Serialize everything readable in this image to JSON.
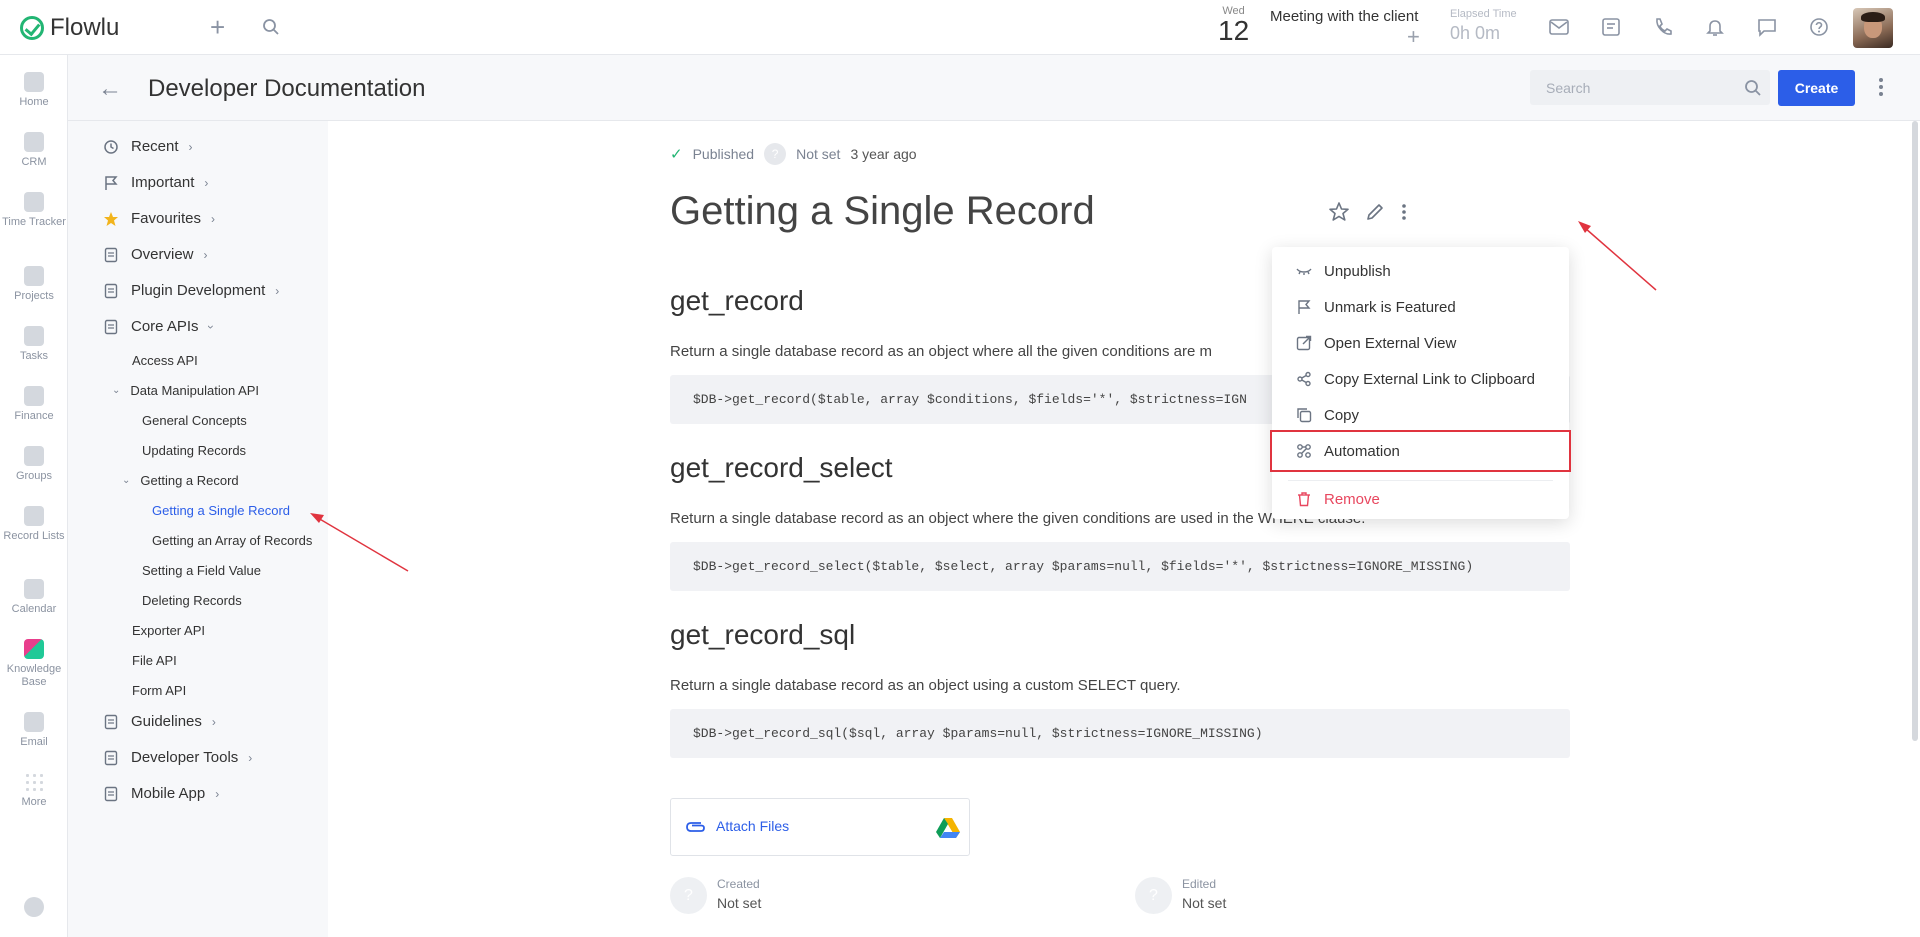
{
  "topbar": {
    "brand": "Flowlu",
    "date": {
      "weekday": "Wed",
      "day": "12"
    },
    "meeting": "Meeting with the client",
    "elapsed": {
      "label": "Elapsed Time",
      "value": "0h 0m"
    }
  },
  "rail": {
    "items": [
      {
        "label": "Home"
      },
      {
        "label": "CRM"
      },
      {
        "label": "Time Tracker"
      },
      {
        "label": "Projects"
      },
      {
        "label": "Tasks"
      },
      {
        "label": "Finance"
      },
      {
        "label": "Groups"
      },
      {
        "label": "Record Lists"
      },
      {
        "label": "Calendar"
      },
      {
        "label": "Knowledge Base"
      },
      {
        "label": "Email"
      },
      {
        "label": "More"
      }
    ]
  },
  "header": {
    "title": "Developer Documentation",
    "search_placeholder": "Search",
    "create_label": "Create"
  },
  "tree": {
    "top": [
      {
        "label": "Recent",
        "icon": "history-icon"
      },
      {
        "label": "Important",
        "icon": "flag-icon"
      },
      {
        "label": "Favourites",
        "icon": "star-icon"
      },
      {
        "label": "Overview",
        "icon": "document-icon"
      },
      {
        "label": "Plugin Development",
        "icon": "document-icon"
      },
      {
        "label": "Core APIs",
        "icon": "document-icon"
      }
    ],
    "sub": [
      {
        "label": "Access API"
      },
      {
        "label": "Data Manipulation API"
      },
      {
        "label": "General Concepts"
      },
      {
        "label": "Updating Records"
      },
      {
        "label": "Getting a Record"
      },
      {
        "label": "Getting a Single Record"
      },
      {
        "label": "Getting an Array of Records"
      },
      {
        "label": "Setting a Field Value"
      },
      {
        "label": "Deleting Records"
      },
      {
        "label": "Exporter API"
      },
      {
        "label": "File API"
      },
      {
        "label": "Form API"
      }
    ],
    "bottom": [
      {
        "label": "Guidelines"
      },
      {
        "label": "Developer Tools"
      },
      {
        "label": "Mobile App"
      }
    ]
  },
  "article": {
    "status": "Published",
    "owner": "Not set",
    "updated": "3 year ago",
    "title": "Getting a Single Record",
    "sections": [
      {
        "heading": "get_record",
        "text": "Return a single database record as an object where all the given conditions are m",
        "code": "$DB->get_record($table, array $conditions, $fields='*', $strictness=IGN"
      },
      {
        "heading": "get_record_select",
        "text": "Return a single database record as an object where the given conditions are used in the WHERE clause.",
        "code": "$DB->get_record_select($table, $select, array $params=null, $fields='*', $strictness=IGNORE_MISSING)"
      },
      {
        "heading": "get_record_sql",
        "text": "Return a single database record as an object using a custom SELECT query.",
        "code": "$DB->get_record_sql($sql, array $params=null, $strictness=IGNORE_MISSING)"
      }
    ],
    "attach_label": "Attach Files",
    "created": {
      "label": "Created",
      "value": "Not set"
    },
    "edited": {
      "label": "Edited",
      "value": "Not set"
    }
  },
  "menu": {
    "items": [
      {
        "label": "Unpublish",
        "icon": "eye-off-icon"
      },
      {
        "label": "Unmark is Featured",
        "icon": "flag-icon"
      },
      {
        "label": "Open External View",
        "icon": "external-link-icon"
      },
      {
        "label": "Copy External Link to Clipboard",
        "icon": "share-icon"
      },
      {
        "label": "Copy",
        "icon": "copy-icon"
      },
      {
        "label": "Automation",
        "icon": "automation-icon"
      },
      {
        "label": "Remove",
        "icon": "trash-icon"
      }
    ]
  },
  "colors": {
    "accent": "#2c5ee8",
    "success": "#22b573",
    "danger": "#e8475f",
    "annotation": "#e0343f"
  }
}
